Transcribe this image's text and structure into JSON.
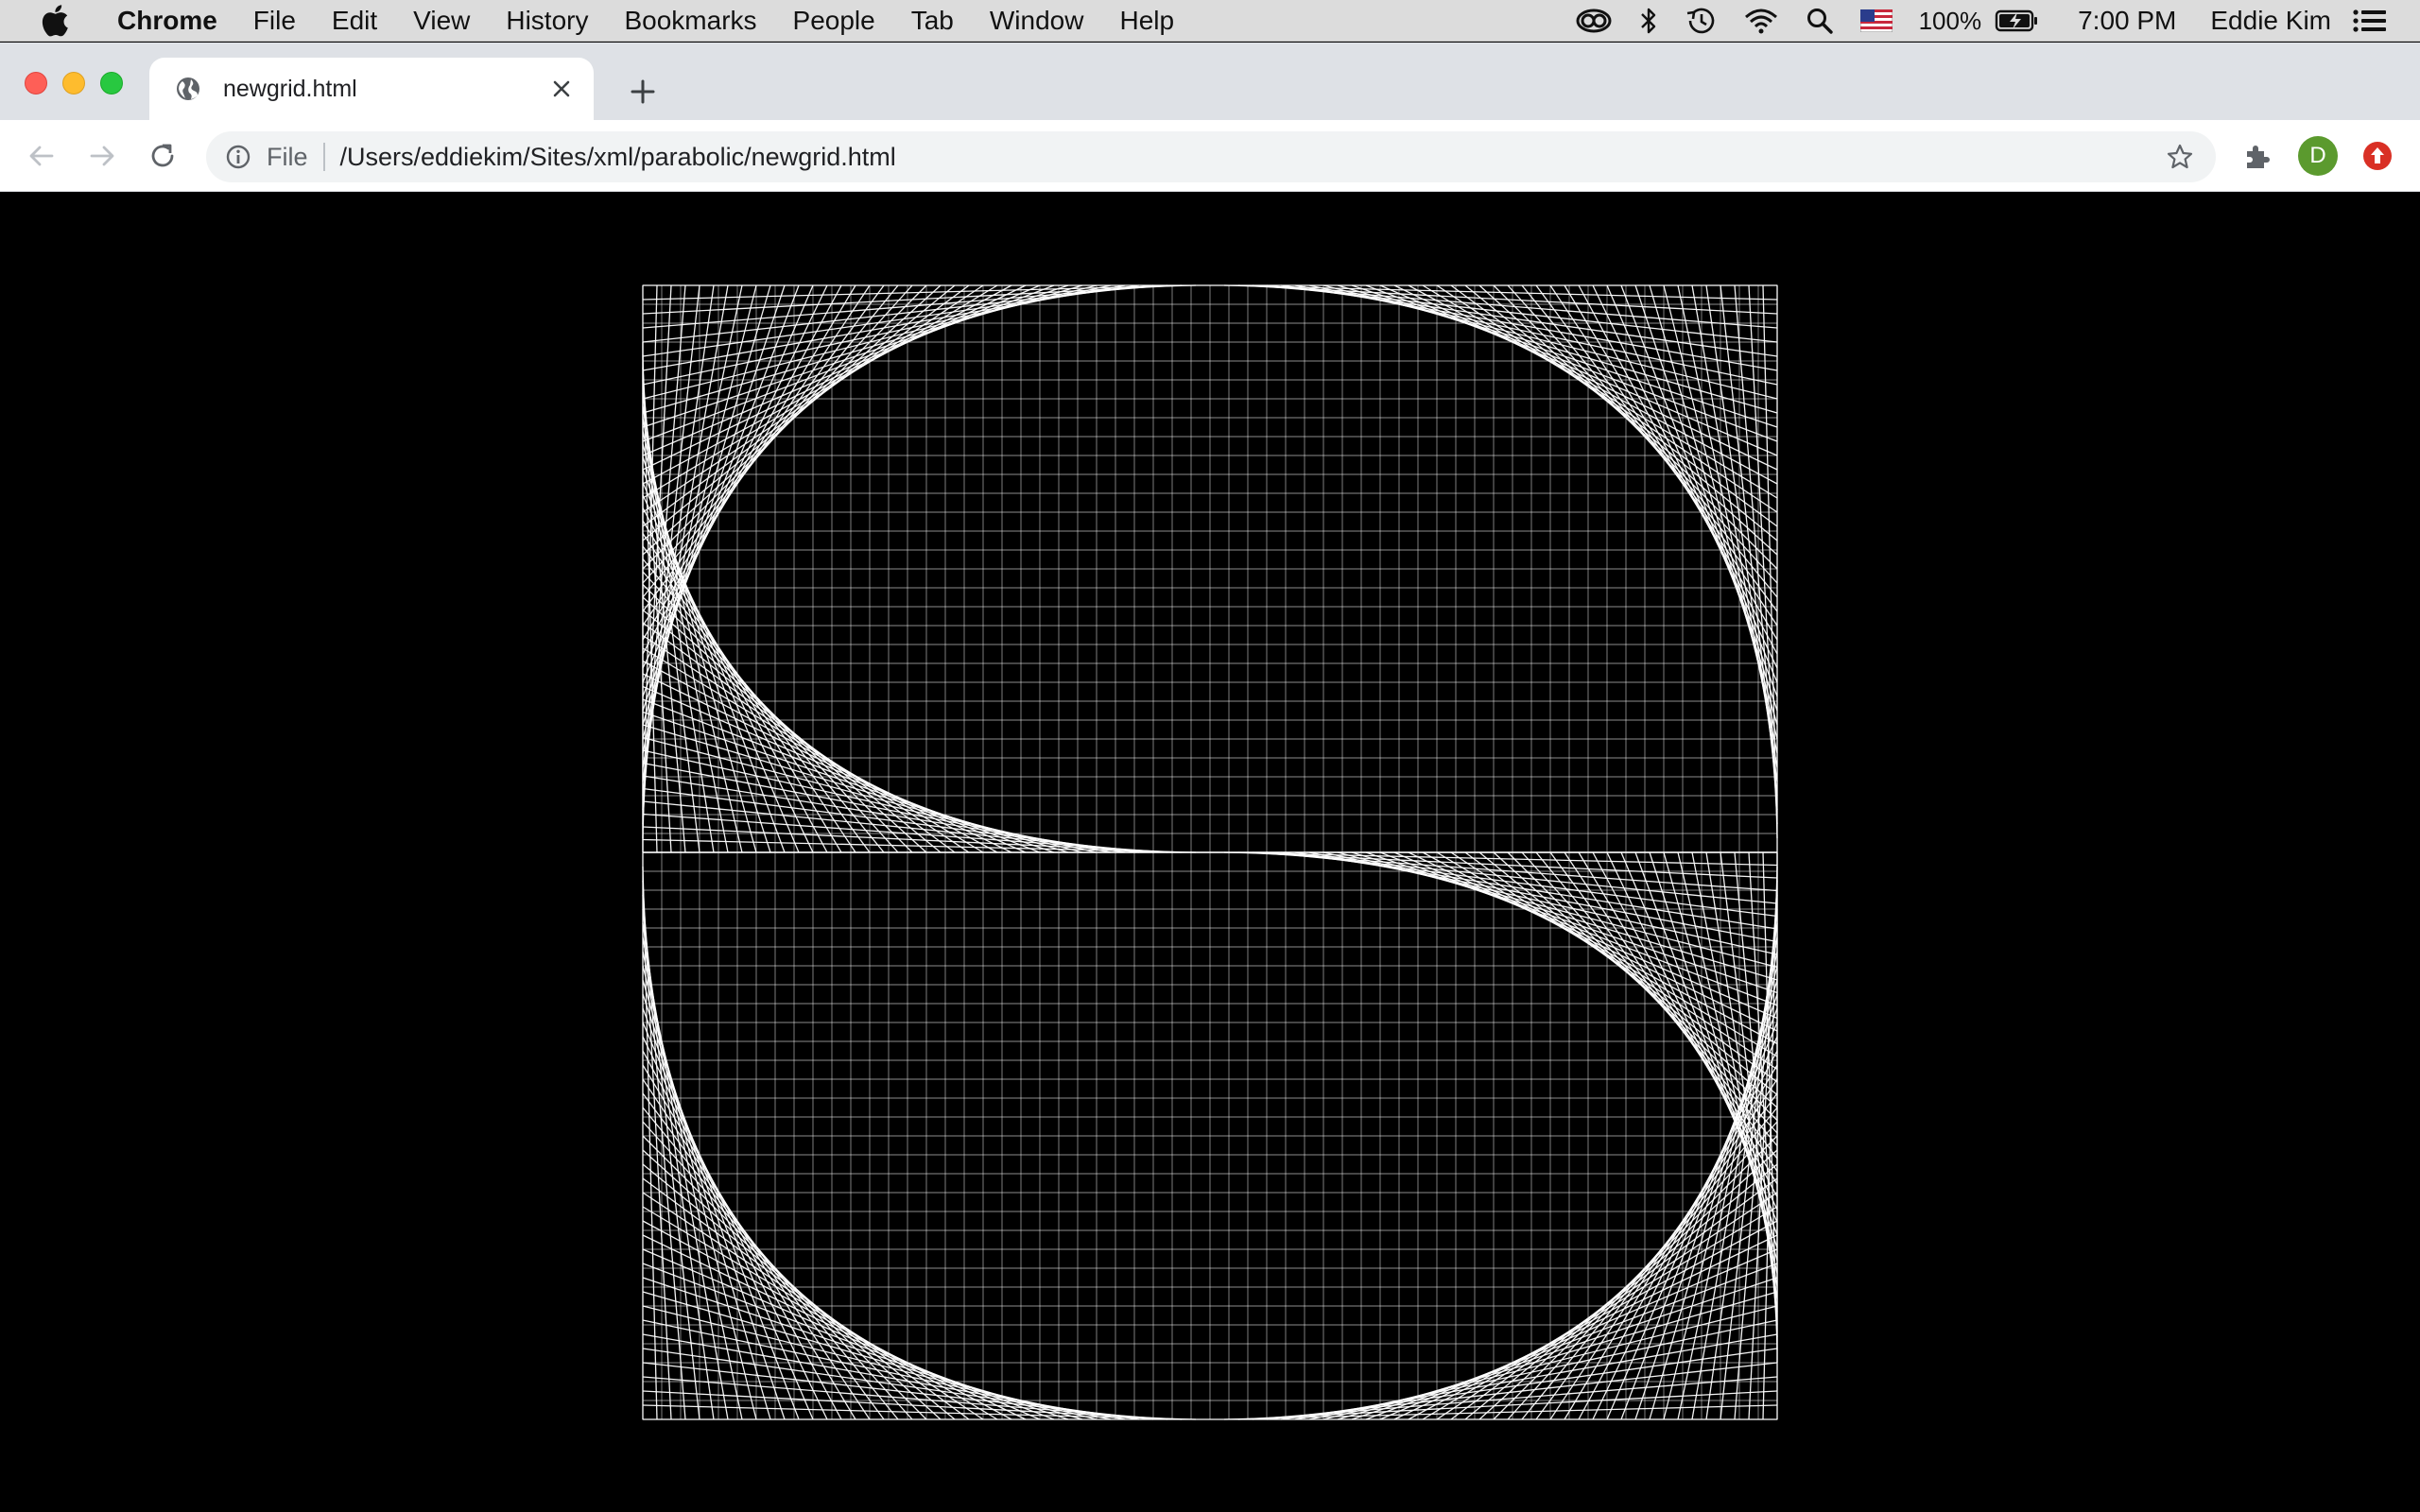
{
  "menubar": {
    "app_name": "Chrome",
    "items": [
      "File",
      "Edit",
      "View",
      "History",
      "Bookmarks",
      "People",
      "Tab",
      "Window",
      "Help"
    ],
    "battery": "100%",
    "clock": "7:00 PM",
    "user": "Eddie Kim",
    "status_icons": [
      "creative-cloud-icon",
      "bluetooth-icon",
      "time-machine-icon",
      "wifi-icon",
      "spotlight-icon",
      "us-flag-icon",
      "battery-charging-icon",
      "control-center-icon"
    ]
  },
  "tab": {
    "title": "newgrid.html",
    "favicon": "globe-icon"
  },
  "omnibox": {
    "scheme": "File",
    "url": "/Users/eddiekim/Sites/xml/parabolic/newgrid.html"
  },
  "profile": {
    "initial": "D",
    "color": "#5b9a2e"
  },
  "update_badge_color": "#d93025",
  "page": {
    "background": "#000000",
    "line_color": "#ffffff",
    "grid_divisions": 60
  }
}
